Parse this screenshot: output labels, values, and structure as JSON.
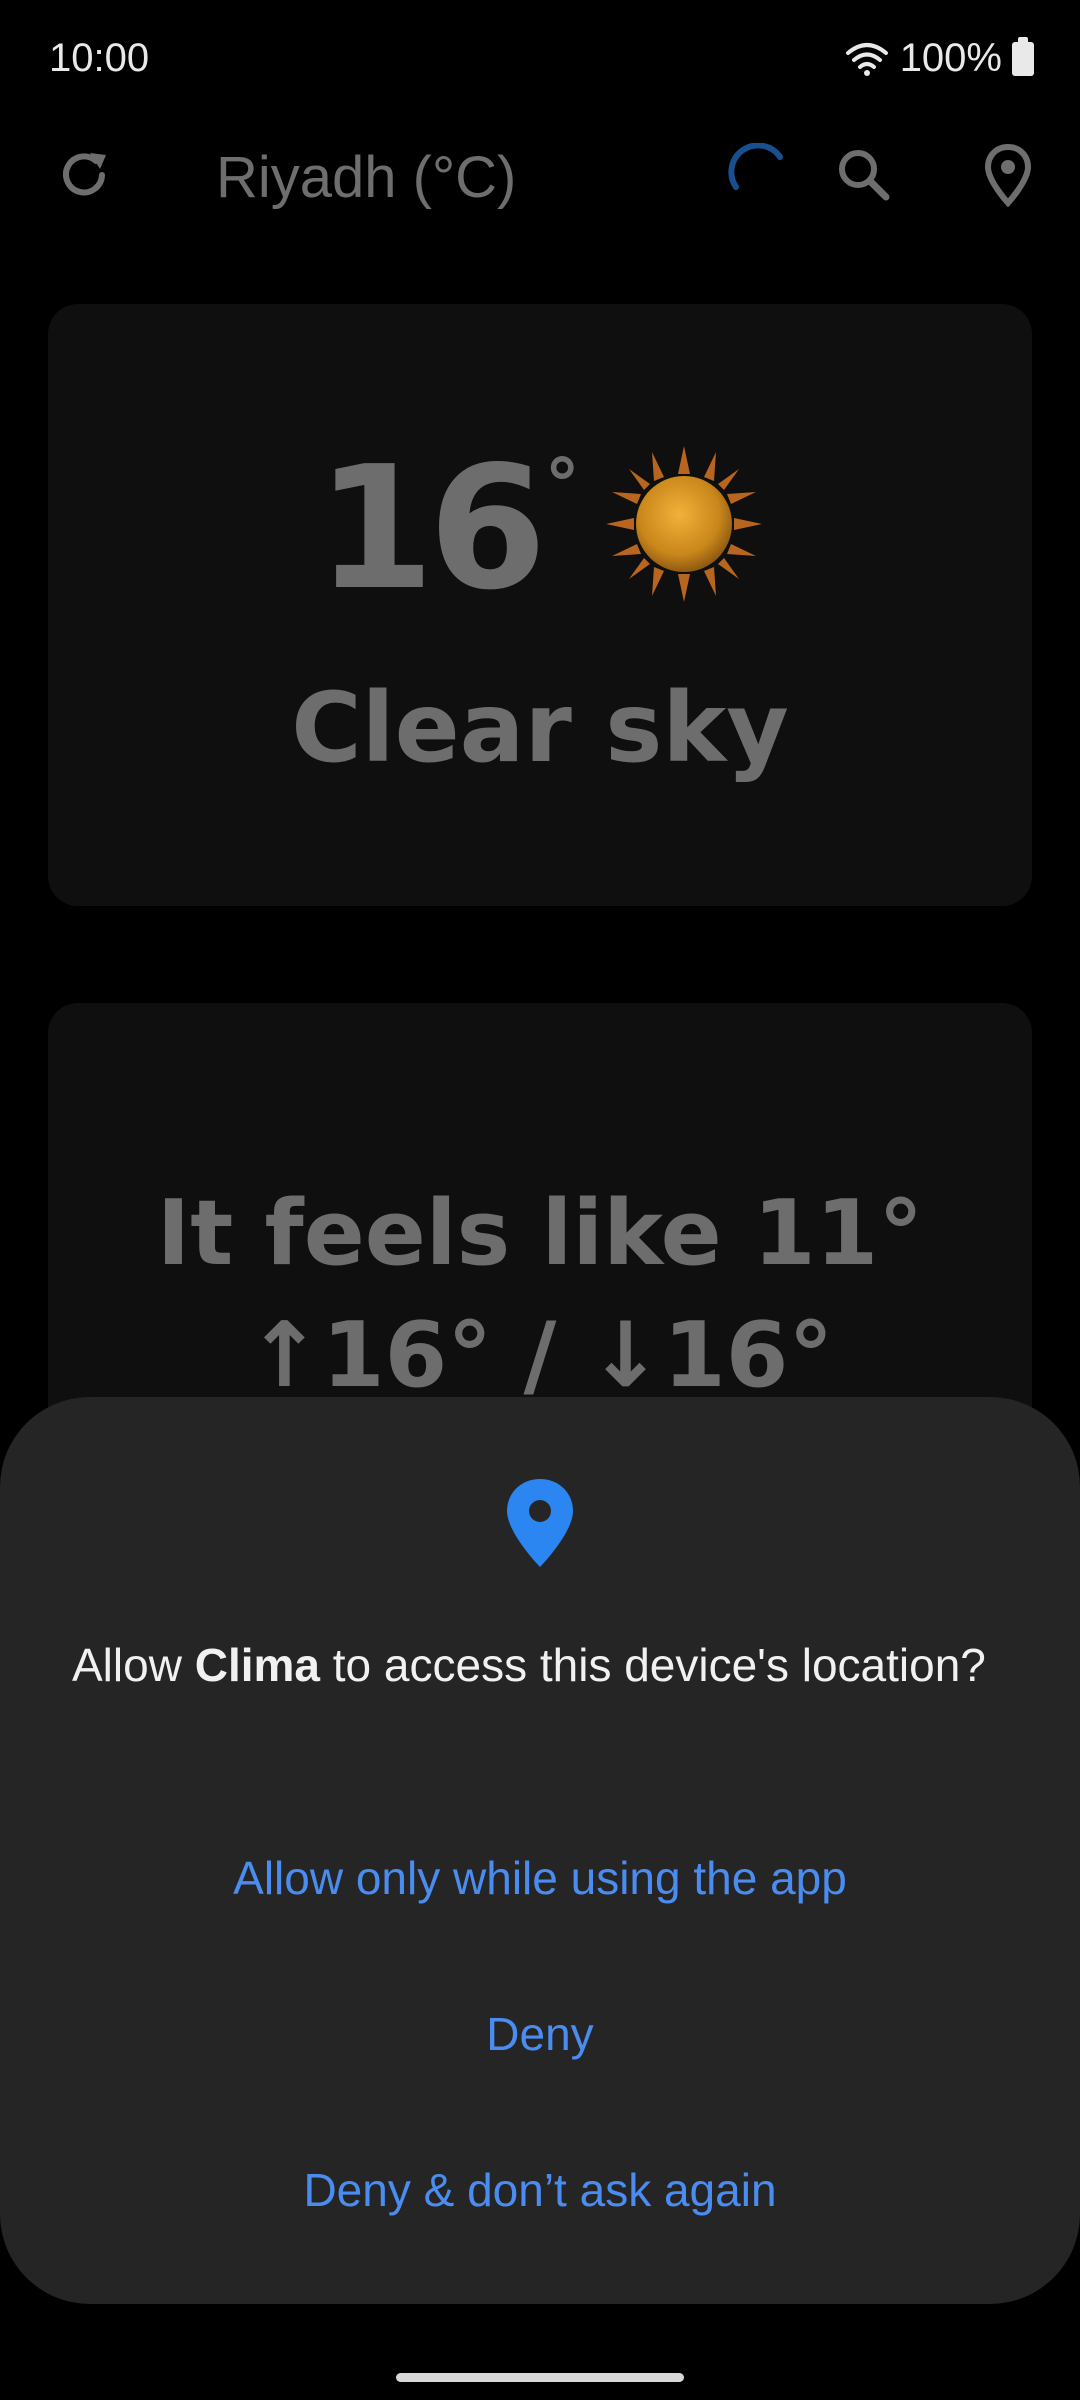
{
  "status_bar": {
    "time": "10:00",
    "battery": "100%"
  },
  "app_bar": {
    "title": "Riyadh (°C)",
    "icons": [
      "refresh-icon",
      "loading-spinner",
      "search-icon",
      "location-pin-icon"
    ]
  },
  "current": {
    "temperature": "16",
    "degree": "°",
    "condition": "Clear sky"
  },
  "details": {
    "feels_like": "It feels like 11°",
    "high_low": "↑16° / ↓16°"
  },
  "dialog": {
    "question_prefix": "Allow ",
    "app_name": "Clima",
    "question_suffix": " to access this device's location?",
    "options": [
      "Allow only while using the app",
      "Deny",
      "Deny & don’t ask again"
    ]
  },
  "colors": {
    "accent": "#4a8cf0",
    "sheet_bg": "#252525",
    "card_bg": "#0f0f0f"
  }
}
